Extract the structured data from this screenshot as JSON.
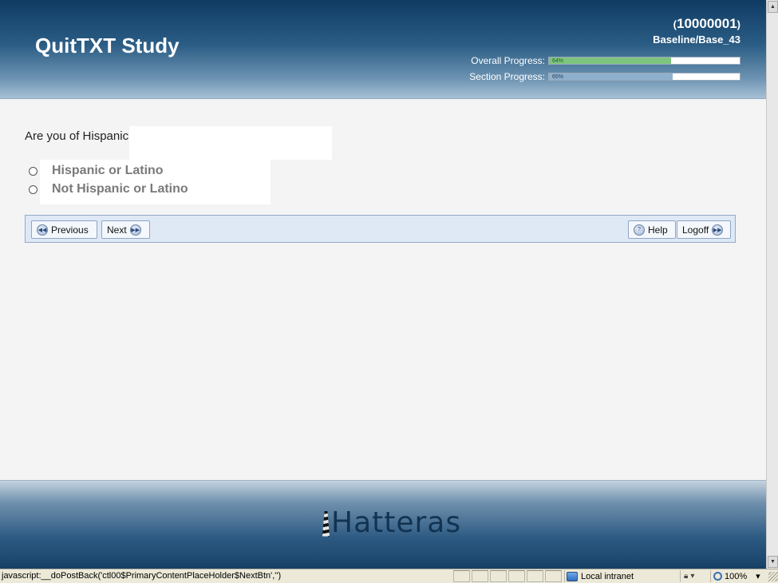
{
  "header": {
    "title": "QuitTXT Study",
    "participant_id_open": "(",
    "participant_id": "10000001",
    "participant_id_close": ")",
    "location": "Baseline/Base_43",
    "overall_label": "Overall Progress:",
    "overall_pct": "64%",
    "overall_value": 64,
    "section_label": "Section Progress:",
    "section_pct": "65%",
    "section_value": 65
  },
  "question": {
    "text": "Are you of Hispanic",
    "options": [
      {
        "label": "Hispanic or Latino",
        "selected": false
      },
      {
        "label": "Not Hispanic or Latino",
        "selected": false
      }
    ]
  },
  "nav": {
    "previous_label": "Previous",
    "next_label": "Next",
    "help_label": "Help",
    "logoff_label": "Logoff",
    "prev_icon": "rewind-icon",
    "next_icon": "fast-forward-icon",
    "help_icon": "help-icon"
  },
  "footer": {
    "logo_text": "Hatteras"
  },
  "statusbar": {
    "url_text": "javascript:__doPostBack('ctl00$PrimaryContentPlaceHolder$NextBtn','')",
    "zone_label": "Local intranet",
    "zoom_label": "100%"
  },
  "colors": {
    "overall_fill": "#7dc47f",
    "section_fill": "#8fb0cc",
    "header_dark": "#0f3b63"
  }
}
